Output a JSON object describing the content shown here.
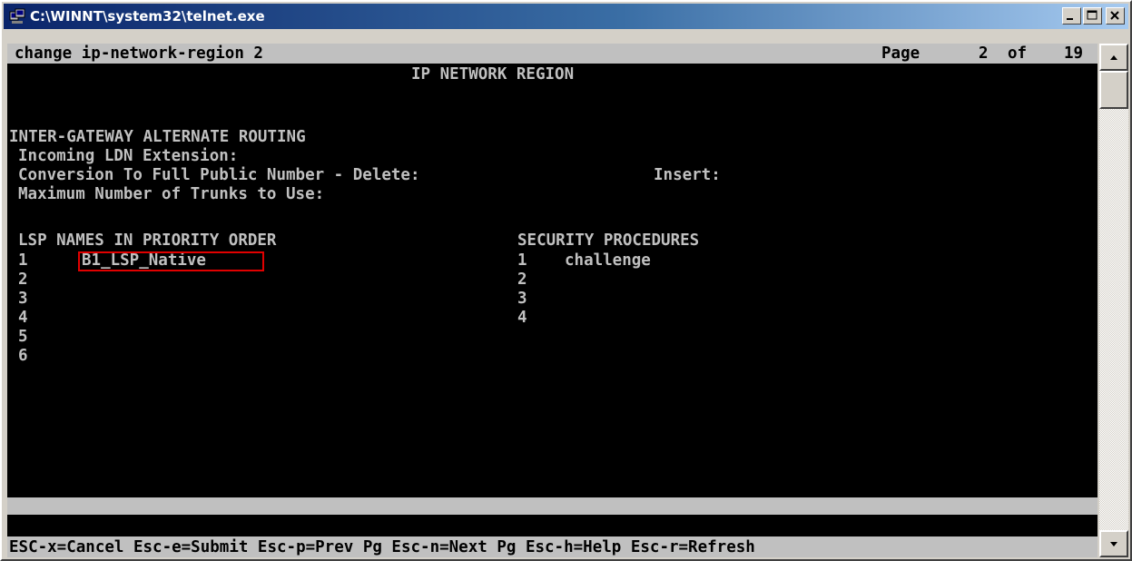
{
  "window": {
    "title": "C:\\WINNT\\system32\\telnet.exe",
    "buttons": {
      "minimize": "minimize",
      "maximize": "maximize",
      "close": "close"
    }
  },
  "terminal": {
    "top_bar": {
      "command": "change ip-network-region 2",
      "page_label": "Page",
      "page_current": "2",
      "page_of": "of",
      "page_total": "19"
    },
    "screen_title": "IP NETWORK REGION",
    "section_heading": "INTER-GATEWAY ALTERNATE ROUTING",
    "fields": {
      "incoming_ldn": "Incoming LDN Extension:",
      "conversion": "Conversion To Full Public Number - Delete:",
      "insert": "Insert:",
      "max_trunks": "Maximum Number of Trunks to Use:"
    },
    "lsp": {
      "heading": "LSP NAMES IN PRIORITY ORDER",
      "rows": [
        {
          "num": "1",
          "name": "B1_LSP_Native"
        },
        {
          "num": "2",
          "name": ""
        },
        {
          "num": "3",
          "name": ""
        },
        {
          "num": "4",
          "name": ""
        },
        {
          "num": "5",
          "name": ""
        },
        {
          "num": "6",
          "name": ""
        }
      ]
    },
    "security": {
      "heading": "SECURITY PROCEDURES",
      "rows": [
        {
          "num": "1",
          "value": "challenge"
        },
        {
          "num": "2",
          "value": ""
        },
        {
          "num": "3",
          "value": ""
        },
        {
          "num": "4",
          "value": ""
        }
      ]
    },
    "function_keys": "ESC-x=Cancel Esc-e=Submit Esc-p=Prev Pg Esc-n=Next Pg Esc-h=Help Esc-r=Refresh"
  },
  "colors": {
    "title_gradient_start": "#0a246a",
    "title_gradient_end": "#a6caf0",
    "terminal_bg": "#000000",
    "terminal_text": "#c0c0c0",
    "highlight_box": "#e00000"
  }
}
